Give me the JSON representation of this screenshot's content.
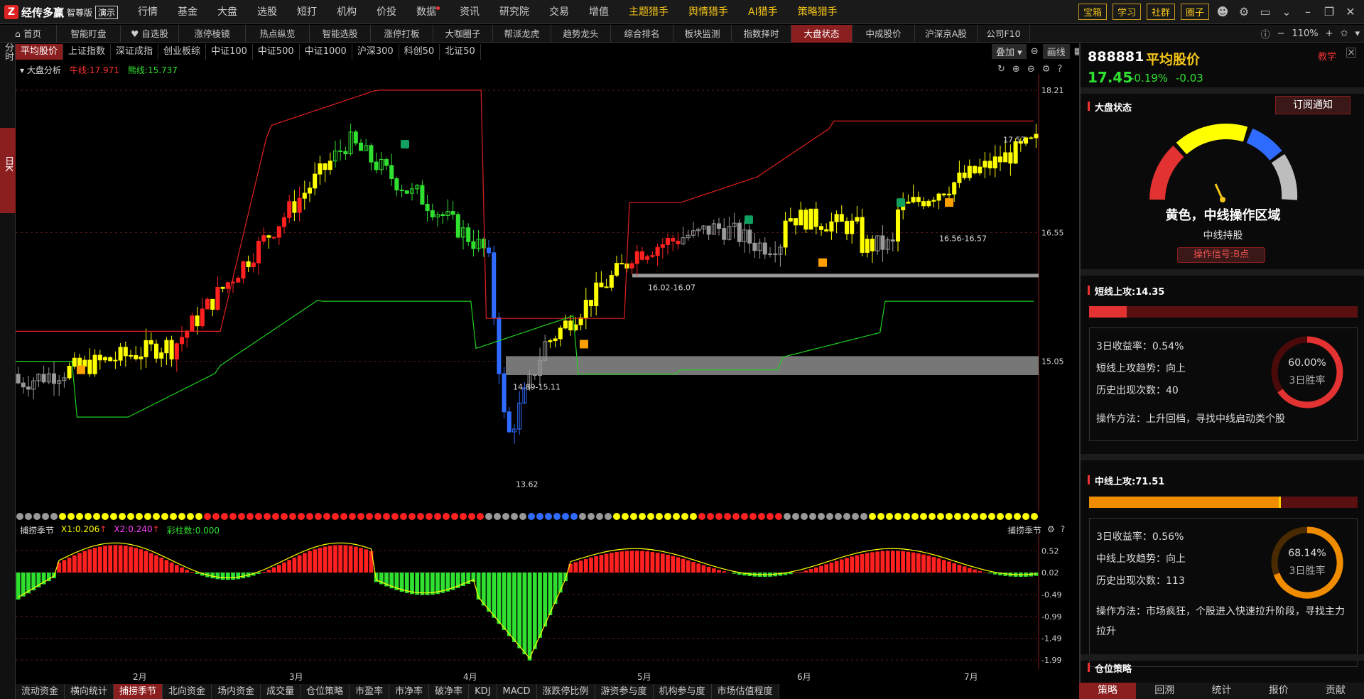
{
  "app": {
    "name": "经传多赢",
    "edition": "智尊版",
    "demo": "演示"
  },
  "menu": [
    {
      "label": "行情"
    },
    {
      "label": "基金"
    },
    {
      "label": "大盘"
    },
    {
      "label": "选股"
    },
    {
      "label": "短打"
    },
    {
      "label": "机构"
    },
    {
      "label": "价投"
    },
    {
      "label": "数据"
    },
    {
      "label": "资讯"
    },
    {
      "label": "研究院"
    },
    {
      "label": "交易"
    },
    {
      "label": "增值"
    },
    {
      "label": "主题猎手"
    },
    {
      "label": "舆情猎手"
    },
    {
      "label": "AI猎手"
    },
    {
      "label": "策略猎手"
    }
  ],
  "top_buttons": [
    "宝箱",
    "学习",
    "社群",
    "圈子"
  ],
  "nav_tabs": [
    "首页",
    "智能盯盘",
    "自选股",
    "涨停棱镜",
    "热点纵览",
    "智能选股",
    "涨停打板",
    "大咖圈子",
    "帮派龙虎",
    "趋势龙头",
    "综合排名",
    "板块监测",
    "指数择时",
    "大盘状态",
    "中成股价",
    "沪深京A股",
    "公司F10"
  ],
  "zoom": "110%",
  "left_bar": {
    "fs": "分时",
    "rk": "日K"
  },
  "index_tabs": [
    "平均股价",
    "上证指数",
    "深证成指",
    "创业板综",
    "中证100",
    "中证500",
    "中证1000",
    "沪深300",
    "科创50",
    "北证50"
  ],
  "chart_controls": {
    "overlay": "叠加",
    "draw": "画线"
  },
  "info_line": {
    "name": "大盘分析",
    "bull": "牛线:17.971",
    "bear": "熊线:15.737"
  },
  "chart_data": {
    "type": "candlestick",
    "y_ticks": [
      "18.21",
      "16.55",
      "15.05"
    ],
    "annotations": [
      "17.57",
      "16.56-16.57",
      "16.02-16.07",
      "14.89-15.11",
      "13.62"
    ],
    "x_labels": [
      "2月",
      "3月",
      "4月",
      "5月",
      "6月",
      "7月"
    ],
    "sub_indicator": {
      "name": "捕捞季节",
      "x1": "X1:0.206",
      "x2": "X2:0.240",
      "bars": "彩柱数:0.000",
      "y_ticks": [
        "0.52",
        "0.02",
        "-0.49",
        "-0.99",
        "-1.49",
        "-1.99"
      ]
    }
  },
  "bottom_tabs": [
    "流动资金",
    "横向统计",
    "捕捞季节",
    "北向资金",
    "场内资金",
    "成交量",
    "仓位策略",
    "市盈率",
    "市净率",
    "破净率",
    "KDJ",
    "MACD",
    "涨跌停比例",
    "游资参与度",
    "机构参与度",
    "市场估值程度"
  ],
  "right_panel": {
    "code": "888881",
    "name": "平均股价",
    "teach": "教学",
    "price": "17.45",
    "change_pct": "-0.19%",
    "change": "-0.03",
    "market_state_title": "大盘状态",
    "subscribe": "订阅通知",
    "state_text": "黄色，中线操作区域",
    "state_sub": "中线持股",
    "signal": "操作信号:B点",
    "short_title": "短线上攻:14.35",
    "short_fill": 0.14,
    "short_box": {
      "r3": "3日收益率：0.54%",
      "trend": "短线上攻趋势：向上",
      "times": "历史出现次数：40",
      "method": "操作方法：上升回档，寻找中线启动类个股",
      "win": "60.00%",
      "win_label": "3日胜率"
    },
    "mid_title": "中线上攻:71.51",
    "mid_fill": 0.7151,
    "mid_box": {
      "r3": "3日收益率：0.56%",
      "trend": "中线上攻趋势：向上",
      "times": "历史出现次数：113",
      "method": "操作方法：市场疯狂，个股进入快速拉升阶段，寻找主力拉升",
      "win": "68.14%",
      "win_label": "3日胜率"
    },
    "pos_title": "仓位策略",
    "bottom": [
      "策略",
      "回溯",
      "统计",
      "报价",
      "贡献"
    ]
  },
  "colors": {
    "accent": "#8b1e1e",
    "up": "#ff2020",
    "down": "#00ff00",
    "yellow": "#ffff00",
    "gold": "#f5c518"
  }
}
